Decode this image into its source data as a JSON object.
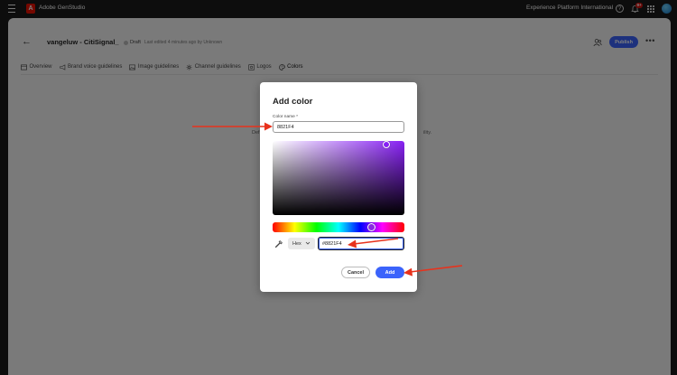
{
  "topbar": {
    "app_name": "Adobe GenStudio",
    "logo_letter": "A",
    "org_name": "Experience Platform International",
    "help_glyph": "?",
    "notification_count": "9+"
  },
  "header": {
    "back_glyph": "←",
    "title": "vangeluw - CitiSignal_",
    "status": "Draft",
    "edited": "Last edited 4 minutes ago by Unknown",
    "publish_label": "Publish",
    "more_glyph": "•••"
  },
  "tabs": [
    {
      "label": "Overview",
      "icon": "overview-icon"
    },
    {
      "label": "Brand voice guidelines",
      "icon": "megaphone-icon"
    },
    {
      "label": "Image guidelines",
      "icon": "image-icon"
    },
    {
      "label": "Channel guidelines",
      "icon": "channel-icon"
    },
    {
      "label": "Logos",
      "icon": "logo-icon"
    },
    {
      "label": "Colors",
      "icon": "palette-icon",
      "active": true
    }
  ],
  "background": {
    "text_left": "Def",
    "text_right": "ility."
  },
  "dialog": {
    "title": "Add color",
    "name_label": "Color name *",
    "name_value": "8821F4",
    "selected_color": "#8821F4",
    "format_value": "Hex",
    "hex_value": "#8821F4",
    "cancel_label": "Cancel",
    "add_label": "Add"
  },
  "colors": {
    "accent": "#3B63FB",
    "annotation": "#E8321C"
  }
}
